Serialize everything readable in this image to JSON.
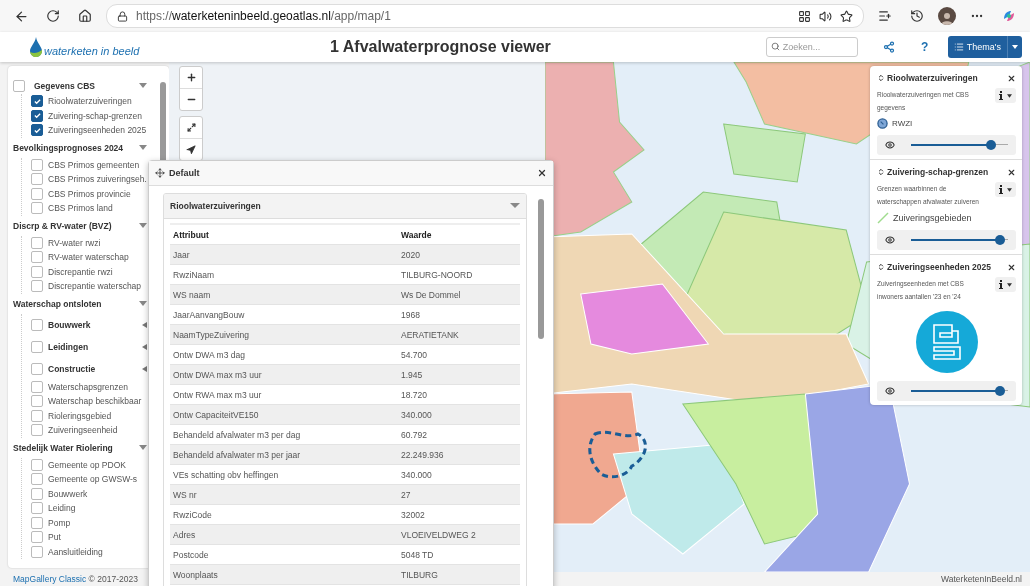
{
  "browser": {
    "url": {
      "scheme": "https://",
      "host": "waterketeninbeeld.geoatlas.nl",
      "path": "/app/map/1"
    }
  },
  "header": {
    "logo_text": "waterketen in beeld",
    "title": "1 Afvalwaterprognose viewer",
    "search": {
      "placeholder": "Zoeken..."
    },
    "help": "?",
    "themes_button": "Thema's"
  },
  "sidebar": {
    "groups": [
      {
        "label": "Gegevens CBS",
        "kind": "checkbox",
        "checked": false,
        "expanded": true,
        "children": [
          {
            "label": "Rioolwaterzuiveringen",
            "kind": "layer",
            "checked": true
          },
          {
            "label": "Zuivering-schap-grenzen",
            "kind": "layer",
            "checked": true
          },
          {
            "label": "Zuiveringseenheden 2025",
            "kind": "layer",
            "checked": true
          }
        ]
      },
      {
        "label": "Bevolkingsprognoses 2024",
        "kind": "heading",
        "expanded": true,
        "children": [
          {
            "label": "CBS Primos gemeenten",
            "kind": "layer",
            "checked": false
          },
          {
            "label": "CBS Primos zuiveringseh.",
            "kind": "layer",
            "checked": false
          },
          {
            "label": "CBS Primos provincie",
            "kind": "layer",
            "checked": false
          },
          {
            "label": "CBS Primos land",
            "kind": "layer",
            "checked": false
          }
        ]
      },
      {
        "label": "Discrp & RV-water (BVZ)",
        "kind": "heading",
        "expanded": true,
        "children": [
          {
            "label": "RV-water rwzi",
            "kind": "layer",
            "checked": false
          },
          {
            "label": "RV-water waterschap",
            "kind": "layer",
            "checked": false
          },
          {
            "label": "Discrepantie rwzi",
            "kind": "layer",
            "checked": false
          },
          {
            "label": "Discrepantie waterschap",
            "kind": "layer",
            "checked": false
          }
        ]
      },
      {
        "label": "Waterschap ontsloten",
        "kind": "heading",
        "expanded": true,
        "children": [
          {
            "label": "Bouwwerk",
            "kind": "folder",
            "checked": false,
            "expanded": false
          },
          {
            "label": "Leidingen",
            "kind": "folder",
            "checked": false,
            "expanded": false
          },
          {
            "label": "Constructie",
            "kind": "folder",
            "checked": false,
            "expanded": false
          },
          {
            "label": "Waterschapsgrenzen",
            "kind": "layer",
            "checked": false
          },
          {
            "label": "Waterschap beschikbaar",
            "kind": "layer",
            "checked": false
          },
          {
            "label": "Rioleringsgebied",
            "kind": "layer",
            "checked": false
          },
          {
            "label": "Zuiveringseenheid",
            "kind": "layer",
            "checked": false
          }
        ]
      },
      {
        "label": "Stedelijk Water Riolering",
        "kind": "heading",
        "expanded": true,
        "children": [
          {
            "label": "Gemeente op PDOK",
            "kind": "layer",
            "checked": false
          },
          {
            "label": "Gemeente op GWSW-s",
            "kind": "layer",
            "checked": false
          },
          {
            "label": "Bouwwerk",
            "kind": "layer",
            "checked": false
          },
          {
            "label": "Leiding",
            "kind": "layer",
            "checked": false
          },
          {
            "label": "Pomp",
            "kind": "layer",
            "checked": false
          },
          {
            "label": "Put",
            "kind": "layer",
            "checked": false
          },
          {
            "label": "Aansluitleiding",
            "kind": "layer",
            "checked": false
          }
        ]
      }
    ]
  },
  "dialog": {
    "title": "Default",
    "section": {
      "title": "Rioolwaterzuiveringen",
      "expanded": true
    },
    "table": {
      "columns": [
        "Attribuut",
        "Waarde"
      ],
      "rows": [
        [
          "Jaar",
          "2020"
        ],
        [
          "RwziNaam",
          "TILBURG-NOORD"
        ],
        [
          "WS naam",
          "Ws De Dommel"
        ],
        [
          "JaarAanvangBouw",
          "1968"
        ],
        [
          "NaamTypeZuivering",
          "AERATIETANK"
        ],
        [
          "Ontw DWA m3 dag",
          "54.700"
        ],
        [
          "Ontw DWA max m3 uur",
          "1.945"
        ],
        [
          "Ontw RWA max m3 uur",
          "18.720"
        ],
        [
          "Ontw CapaciteitVE150",
          "340.000"
        ],
        [
          "Behandeld afvalwater m3 per dag",
          "60.792"
        ],
        [
          "Behandeld afvalwater m3 per jaar",
          "22.249.936"
        ],
        [
          "VEs schatting obv heffingen",
          "340.000"
        ],
        [
          "WS nr",
          "27"
        ],
        [
          "RwziCode",
          "32002"
        ],
        [
          "Adres",
          "VLOEIVELDWEG 2"
        ],
        [
          "Postcode",
          "5048 TD"
        ],
        [
          "Woonplaats",
          "TILBURG"
        ]
      ]
    }
  },
  "layer_panel": {
    "layers": [
      {
        "title": "Rioolwaterzuiveringen",
        "description": "Rioolwaterzuiveringen met CBS gegevens",
        "legend": {
          "kind": "point",
          "label": "RWZI"
        },
        "opacity": {
          "level": 0.82
        }
      },
      {
        "title": "Zuivering-schap-grenzen",
        "description": "Grenzen waarbinnen de waterschappen afvalwater zuiveren",
        "legend": {
          "kind": "line",
          "label": "Zuiveringsgebieden"
        },
        "opacity": {
          "level": 0.92
        }
      },
      {
        "title": "Zuiveringseenheden 2025",
        "description": "Zuiveringseenheden met CBS inwoners aantallen '23 en '24",
        "legend": {
          "kind": "logo"
        },
        "opacity": {
          "level": 0.92
        }
      }
    ]
  },
  "footer": {
    "link": "MapGallery Classic",
    "copyright": "© 2017-2023",
    "site": "WaterketenInBeeld.nl"
  }
}
